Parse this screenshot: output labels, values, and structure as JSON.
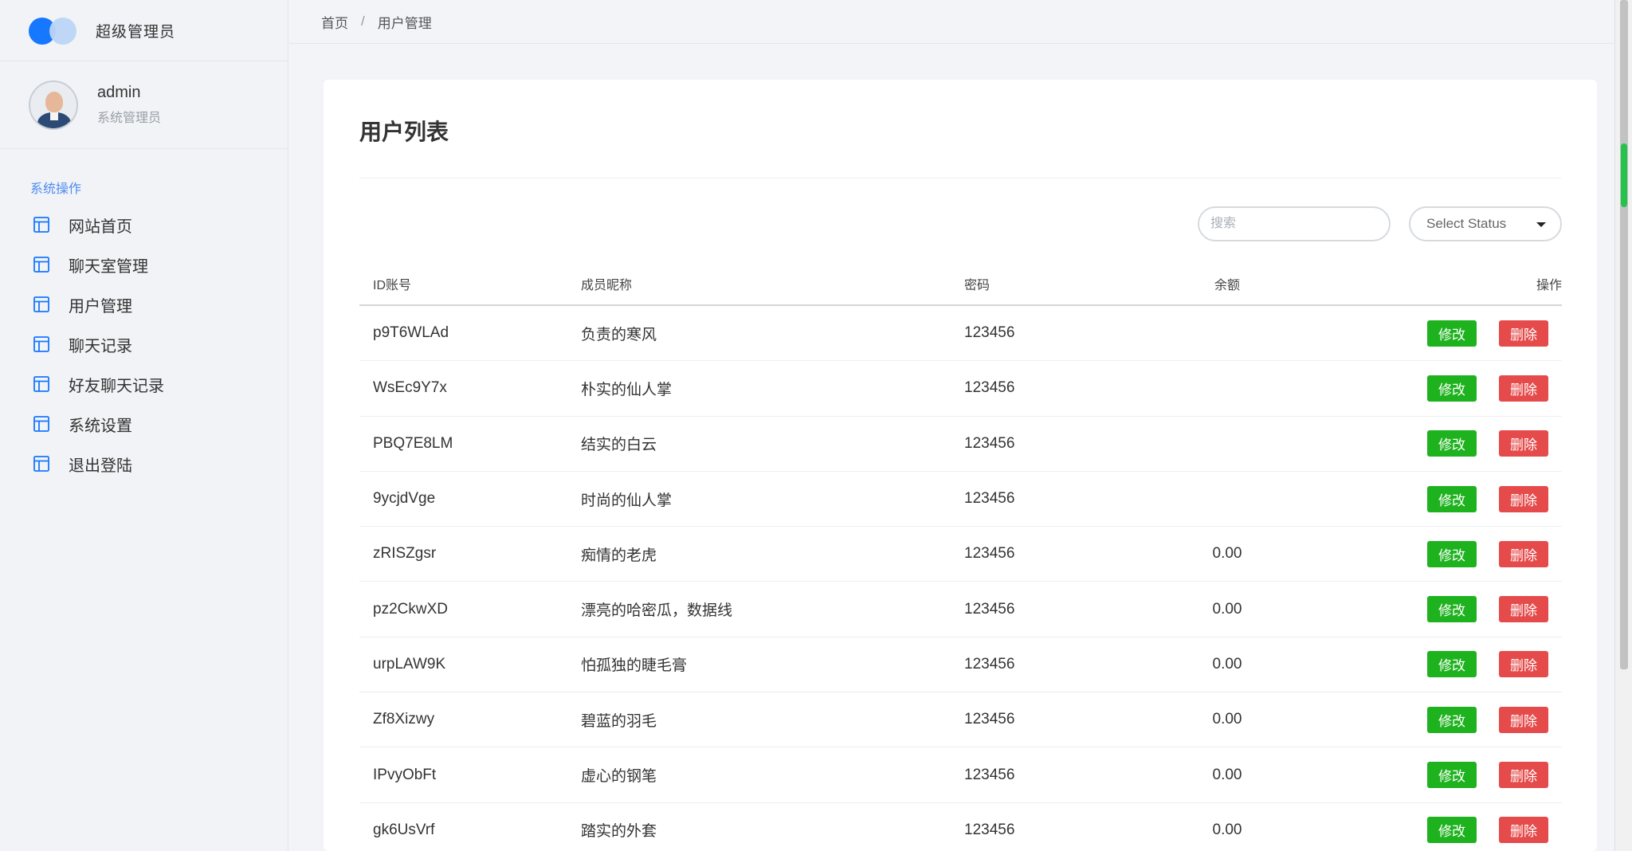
{
  "brand": {
    "title": "超级管理员"
  },
  "user": {
    "name": "admin",
    "role": "系统管理员"
  },
  "nav": {
    "heading": "系统操作",
    "items": [
      {
        "label": "网站首页",
        "icon": "layout-icon"
      },
      {
        "label": "聊天室管理",
        "icon": "layout-icon"
      },
      {
        "label": "用户管理",
        "icon": "layout-icon"
      },
      {
        "label": "聊天记录",
        "icon": "layout-icon"
      },
      {
        "label": "好友聊天记录",
        "icon": "layout-icon"
      },
      {
        "label": "系统设置",
        "icon": "layout-icon"
      },
      {
        "label": "退出登陆",
        "icon": "layout-icon"
      }
    ]
  },
  "breadcrumb": {
    "home": "首页",
    "separator": "/",
    "current": "用户管理"
  },
  "page": {
    "title": "用户列表"
  },
  "search": {
    "placeholder": "搜索"
  },
  "status_select": {
    "value": "Select Status"
  },
  "table": {
    "columns": [
      "ID账号",
      "成员昵称",
      "密码",
      "余额",
      "操作"
    ],
    "rows": [
      {
        "id": "p9T6WLAd",
        "nickname": "负责的寒风",
        "password": "123456",
        "balance": ""
      },
      {
        "id": "WsEc9Y7x",
        "nickname": "朴实的仙人掌",
        "password": "123456",
        "balance": ""
      },
      {
        "id": "PBQ7E8LM",
        "nickname": "结实的白云",
        "password": "123456",
        "balance": ""
      },
      {
        "id": "9ycjdVge",
        "nickname": "时尚的仙人掌",
        "password": "123456",
        "balance": ""
      },
      {
        "id": "zRISZgsr",
        "nickname": "痴情的老虎",
        "password": "123456",
        "balance": "0.00"
      },
      {
        "id": "pz2CkwXD",
        "nickname": "漂亮的哈密瓜，数据线",
        "password": "123456",
        "balance": "0.00"
      },
      {
        "id": "urpLAW9K",
        "nickname": "怕孤独的睫毛膏",
        "password": "123456",
        "balance": "0.00"
      },
      {
        "id": "Zf8Xizwy",
        "nickname": "碧蓝的羽毛",
        "password": "123456",
        "balance": "0.00"
      },
      {
        "id": "IPvyObFt",
        "nickname": "虚心的钢笔",
        "password": "123456",
        "balance": "0.00"
      },
      {
        "id": "gk6UsVrf",
        "nickname": "踏实的外套",
        "password": "123456",
        "balance": "0.00"
      }
    ],
    "edit_label": "修改",
    "delete_label": "删除"
  },
  "colors": {
    "brand_blue": "#1677ff",
    "edit_green": "#1eb21e",
    "delete_red": "#e54b4b",
    "nav_heading": "#4e8cf0"
  }
}
